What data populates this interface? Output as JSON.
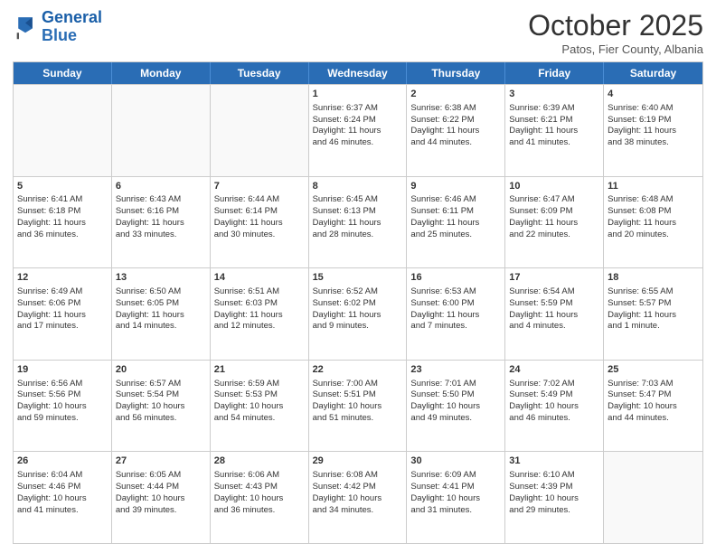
{
  "logo": {
    "line1": "General",
    "line2": "Blue"
  },
  "title": "October 2025",
  "subtitle": "Patos, Fier County, Albania",
  "days": [
    "Sunday",
    "Monday",
    "Tuesday",
    "Wednesday",
    "Thursday",
    "Friday",
    "Saturday"
  ],
  "rows": [
    [
      {
        "num": "",
        "lines": []
      },
      {
        "num": "",
        "lines": []
      },
      {
        "num": "",
        "lines": []
      },
      {
        "num": "1",
        "lines": [
          "Sunrise: 6:37 AM",
          "Sunset: 6:24 PM",
          "Daylight: 11 hours",
          "and 46 minutes."
        ]
      },
      {
        "num": "2",
        "lines": [
          "Sunrise: 6:38 AM",
          "Sunset: 6:22 PM",
          "Daylight: 11 hours",
          "and 44 minutes."
        ]
      },
      {
        "num": "3",
        "lines": [
          "Sunrise: 6:39 AM",
          "Sunset: 6:21 PM",
          "Daylight: 11 hours",
          "and 41 minutes."
        ]
      },
      {
        "num": "4",
        "lines": [
          "Sunrise: 6:40 AM",
          "Sunset: 6:19 PM",
          "Daylight: 11 hours",
          "and 38 minutes."
        ]
      }
    ],
    [
      {
        "num": "5",
        "lines": [
          "Sunrise: 6:41 AM",
          "Sunset: 6:18 PM",
          "Daylight: 11 hours",
          "and 36 minutes."
        ]
      },
      {
        "num": "6",
        "lines": [
          "Sunrise: 6:43 AM",
          "Sunset: 6:16 PM",
          "Daylight: 11 hours",
          "and 33 minutes."
        ]
      },
      {
        "num": "7",
        "lines": [
          "Sunrise: 6:44 AM",
          "Sunset: 6:14 PM",
          "Daylight: 11 hours",
          "and 30 minutes."
        ]
      },
      {
        "num": "8",
        "lines": [
          "Sunrise: 6:45 AM",
          "Sunset: 6:13 PM",
          "Daylight: 11 hours",
          "and 28 minutes."
        ]
      },
      {
        "num": "9",
        "lines": [
          "Sunrise: 6:46 AM",
          "Sunset: 6:11 PM",
          "Daylight: 11 hours",
          "and 25 minutes."
        ]
      },
      {
        "num": "10",
        "lines": [
          "Sunrise: 6:47 AM",
          "Sunset: 6:09 PM",
          "Daylight: 11 hours",
          "and 22 minutes."
        ]
      },
      {
        "num": "11",
        "lines": [
          "Sunrise: 6:48 AM",
          "Sunset: 6:08 PM",
          "Daylight: 11 hours",
          "and 20 minutes."
        ]
      }
    ],
    [
      {
        "num": "12",
        "lines": [
          "Sunrise: 6:49 AM",
          "Sunset: 6:06 PM",
          "Daylight: 11 hours",
          "and 17 minutes."
        ]
      },
      {
        "num": "13",
        "lines": [
          "Sunrise: 6:50 AM",
          "Sunset: 6:05 PM",
          "Daylight: 11 hours",
          "and 14 minutes."
        ]
      },
      {
        "num": "14",
        "lines": [
          "Sunrise: 6:51 AM",
          "Sunset: 6:03 PM",
          "Daylight: 11 hours",
          "and 12 minutes."
        ]
      },
      {
        "num": "15",
        "lines": [
          "Sunrise: 6:52 AM",
          "Sunset: 6:02 PM",
          "Daylight: 11 hours",
          "and 9 minutes."
        ]
      },
      {
        "num": "16",
        "lines": [
          "Sunrise: 6:53 AM",
          "Sunset: 6:00 PM",
          "Daylight: 11 hours",
          "and 7 minutes."
        ]
      },
      {
        "num": "17",
        "lines": [
          "Sunrise: 6:54 AM",
          "Sunset: 5:59 PM",
          "Daylight: 11 hours",
          "and 4 minutes."
        ]
      },
      {
        "num": "18",
        "lines": [
          "Sunrise: 6:55 AM",
          "Sunset: 5:57 PM",
          "Daylight: 11 hours",
          "and 1 minute."
        ]
      }
    ],
    [
      {
        "num": "19",
        "lines": [
          "Sunrise: 6:56 AM",
          "Sunset: 5:56 PM",
          "Daylight: 10 hours",
          "and 59 minutes."
        ]
      },
      {
        "num": "20",
        "lines": [
          "Sunrise: 6:57 AM",
          "Sunset: 5:54 PM",
          "Daylight: 10 hours",
          "and 56 minutes."
        ]
      },
      {
        "num": "21",
        "lines": [
          "Sunrise: 6:59 AM",
          "Sunset: 5:53 PM",
          "Daylight: 10 hours",
          "and 54 minutes."
        ]
      },
      {
        "num": "22",
        "lines": [
          "Sunrise: 7:00 AM",
          "Sunset: 5:51 PM",
          "Daylight: 10 hours",
          "and 51 minutes."
        ]
      },
      {
        "num": "23",
        "lines": [
          "Sunrise: 7:01 AM",
          "Sunset: 5:50 PM",
          "Daylight: 10 hours",
          "and 49 minutes."
        ]
      },
      {
        "num": "24",
        "lines": [
          "Sunrise: 7:02 AM",
          "Sunset: 5:49 PM",
          "Daylight: 10 hours",
          "and 46 minutes."
        ]
      },
      {
        "num": "25",
        "lines": [
          "Sunrise: 7:03 AM",
          "Sunset: 5:47 PM",
          "Daylight: 10 hours",
          "and 44 minutes."
        ]
      }
    ],
    [
      {
        "num": "26",
        "lines": [
          "Sunrise: 6:04 AM",
          "Sunset: 4:46 PM",
          "Daylight: 10 hours",
          "and 41 minutes."
        ]
      },
      {
        "num": "27",
        "lines": [
          "Sunrise: 6:05 AM",
          "Sunset: 4:44 PM",
          "Daylight: 10 hours",
          "and 39 minutes."
        ]
      },
      {
        "num": "28",
        "lines": [
          "Sunrise: 6:06 AM",
          "Sunset: 4:43 PM",
          "Daylight: 10 hours",
          "and 36 minutes."
        ]
      },
      {
        "num": "29",
        "lines": [
          "Sunrise: 6:08 AM",
          "Sunset: 4:42 PM",
          "Daylight: 10 hours",
          "and 34 minutes."
        ]
      },
      {
        "num": "30",
        "lines": [
          "Sunrise: 6:09 AM",
          "Sunset: 4:41 PM",
          "Daylight: 10 hours",
          "and 31 minutes."
        ]
      },
      {
        "num": "31",
        "lines": [
          "Sunrise: 6:10 AM",
          "Sunset: 4:39 PM",
          "Daylight: 10 hours",
          "and 29 minutes."
        ]
      },
      {
        "num": "",
        "lines": []
      }
    ]
  ]
}
